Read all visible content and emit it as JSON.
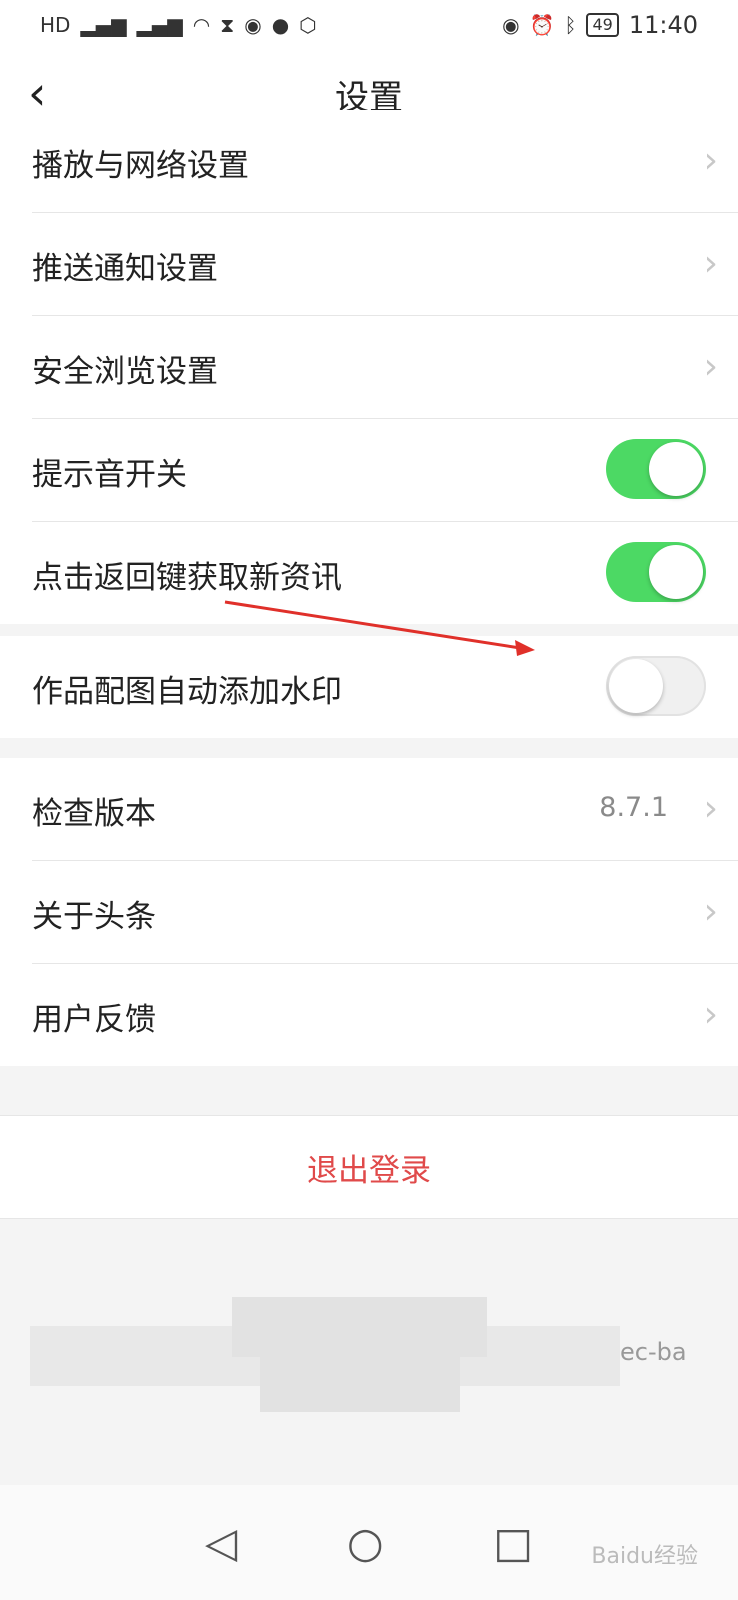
{
  "status_bar": {
    "left_icons": [
      "HD2",
      "2G",
      "4G",
      "wifi-icon",
      "hourglass-icon",
      "wechat-icon",
      "qq-icon",
      "shield-icon"
    ],
    "battery": "49",
    "time": "11:40"
  },
  "nav": {
    "back_glyph": "‹",
    "title": "设置"
  },
  "group1": {
    "rows": [
      {
        "label": "播放与网络设置"
      },
      {
        "label": "推送通知设置"
      },
      {
        "label": "安全浏览设置"
      }
    ],
    "toggles": [
      {
        "label": "提示音开关",
        "on": true
      },
      {
        "label": "点击返回键获取新资讯",
        "on": true
      }
    ]
  },
  "group2": {
    "toggle": {
      "label": "作品配图自动添加水印",
      "on": false
    }
  },
  "group3": {
    "rows": [
      {
        "label": "检查版本",
        "value": "8.7.1"
      },
      {
        "label": "关于头条"
      },
      {
        "label": "用户反馈"
      }
    ]
  },
  "logout": {
    "label": "退出登录"
  },
  "footer": {
    "fragment": "ec-ba"
  },
  "system_nav": {
    "back": "◁",
    "home": "○",
    "recent": "□"
  },
  "watermark": "Baidu经验",
  "colors": {
    "toggle_on": "#4cd964",
    "logout": "#e04a4a",
    "arrow": "#e0302a"
  }
}
